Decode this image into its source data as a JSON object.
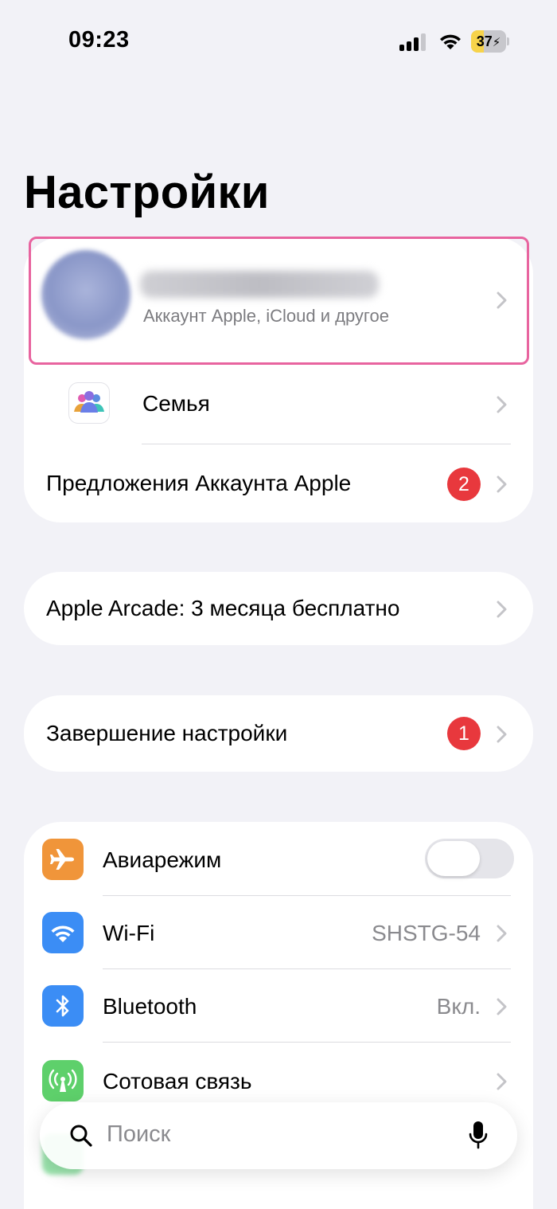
{
  "status_bar": {
    "time": "09:23",
    "battery_level": "37",
    "battery_fraction": 0.37,
    "battery_color": "#f7d34a",
    "signal_bars_filled": 3,
    "signal_bars_total": 4
  },
  "page": {
    "title": "Настройки"
  },
  "account": {
    "subtitle": "Аккаунт Apple, iCloud и другое",
    "name_blurred": true
  },
  "family": {
    "label": "Семья"
  },
  "account_offers": {
    "label": "Предложения Аккаунта Apple",
    "badge": "2"
  },
  "arcade": {
    "label": "Apple Arcade: 3 месяца бесплатно"
  },
  "finish_setup": {
    "label": "Завершение настройки",
    "badge": "1"
  },
  "settings": [
    {
      "label": "Авиарежим",
      "icon": "airplane-icon",
      "color": "#f0953a",
      "toggle": false
    },
    {
      "label": "Wi-Fi",
      "icon": "wifi-icon",
      "color": "#3b8df5",
      "value": "SHSTG-54"
    },
    {
      "label": "Bluetooth",
      "icon": "bluetooth-icon",
      "color": "#3b8df5",
      "value": "Вкл."
    },
    {
      "label": "Сотовая связь",
      "icon": "cellular-icon",
      "color": "#5ed06b"
    }
  ],
  "search": {
    "placeholder": "Поиск"
  },
  "colors": {
    "background": "#f2f2f7",
    "badge": "#e8383d",
    "highlight": "#e8649f"
  }
}
